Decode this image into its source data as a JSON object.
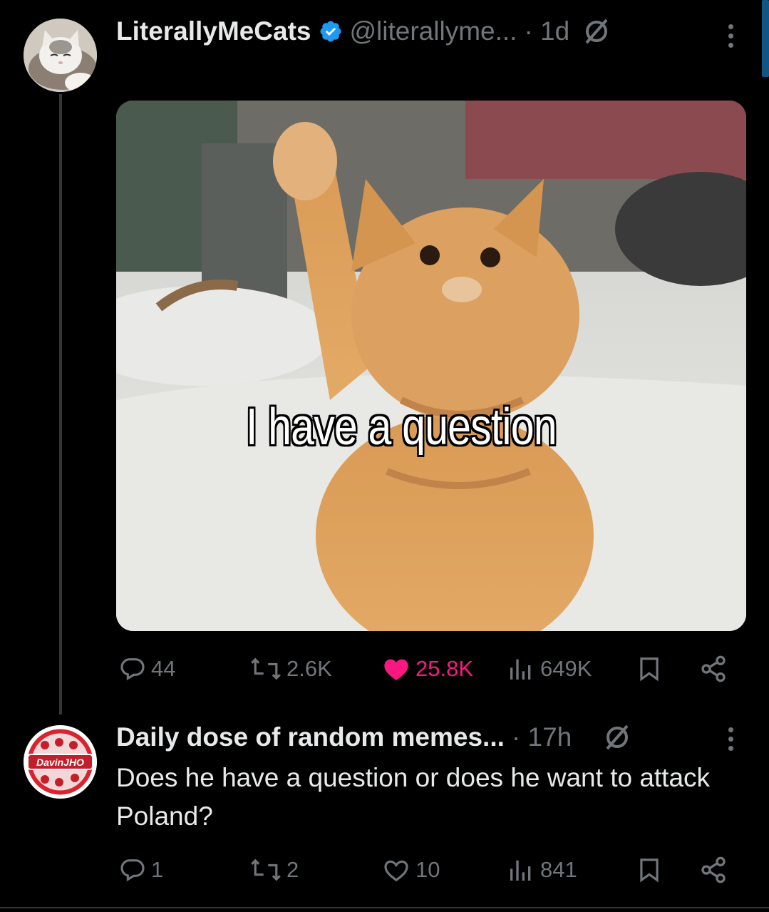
{
  "post1": {
    "display_name": "LiterallyMeCats",
    "handle": "@literallyme...",
    "time": "· 1d",
    "verified": true,
    "media_caption": "I have a question",
    "avatar_icon": "cat-avatar",
    "actions": {
      "replies": "44",
      "reposts": "2.6K",
      "likes": "25.8K",
      "views": "649K"
    }
  },
  "post2": {
    "display_name": "Daily dose of random memes...",
    "time": "· 17h",
    "avatar_label": "DavinJHO",
    "text": "Does he have a question or does he want to attack Poland?",
    "actions": {
      "replies": "1",
      "reposts": "2",
      "likes": "10",
      "views": "841"
    }
  },
  "colors": {
    "background": "#000000",
    "muted": "#71767b",
    "like": "#f91880",
    "verified": "#1d9bf0"
  }
}
